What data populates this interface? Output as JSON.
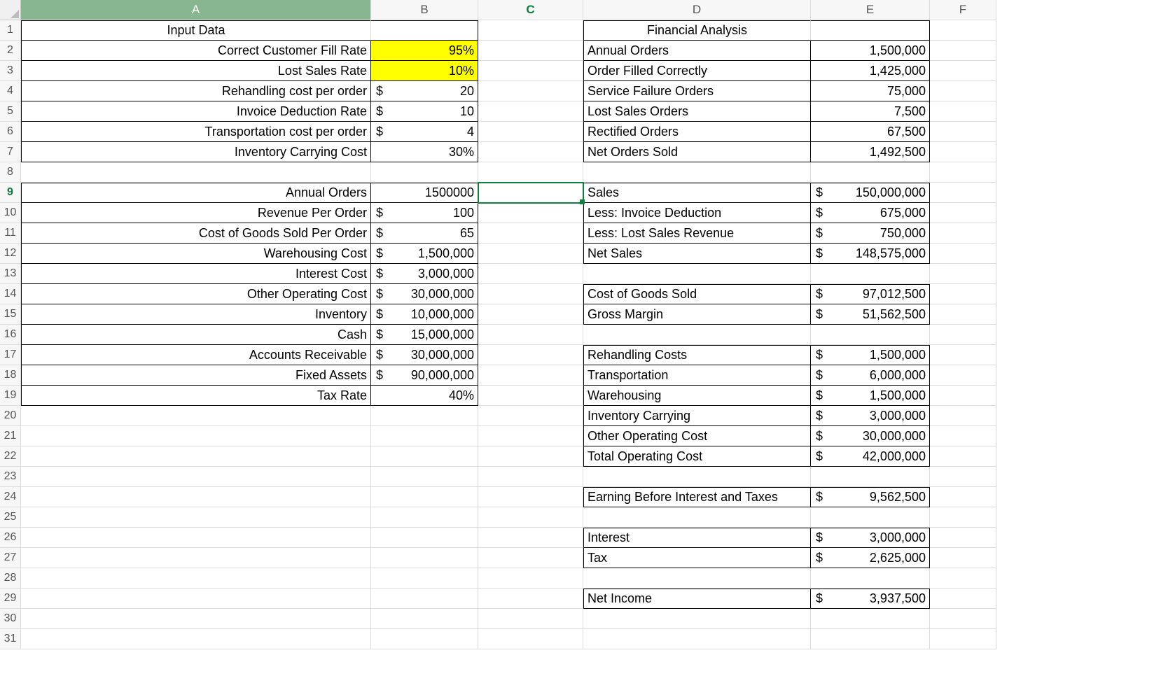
{
  "columns": [
    "A",
    "B",
    "C",
    "D",
    "E",
    "F"
  ],
  "rowCount": 31,
  "activeCell": {
    "row": 9,
    "col": "C"
  },
  "selectedColumn": "A",
  "cells": {
    "A1": {
      "v": "Input Data",
      "align": "center",
      "b": "bl bt bb"
    },
    "B1": {
      "v": "",
      "b": "bt br bb"
    },
    "A2": {
      "v": "Correct Customer Fill Rate",
      "align": "right",
      "b": "bl bb br"
    },
    "B2": {
      "v": "95%",
      "align": "right",
      "cls": "yellow",
      "b": "br bb"
    },
    "A3": {
      "v": "Lost Sales Rate",
      "align": "right",
      "b": "bl bb br"
    },
    "B3": {
      "v": "10%",
      "align": "right",
      "cls": "yellow",
      "b": "br bb"
    },
    "A4": {
      "v": "Rehandling cost per order",
      "align": "right",
      "b": "bl bb br"
    },
    "B4": {
      "v": "20",
      "acct": true,
      "b": "br bb"
    },
    "A5": {
      "v": "Invoice Deduction Rate",
      "align": "right",
      "b": "bl bb br"
    },
    "B5": {
      "v": "10",
      "acct": true,
      "b": "br bb"
    },
    "A6": {
      "v": "Transportation cost per order",
      "align": "right",
      "b": "bl bb br"
    },
    "B6": {
      "v": "4",
      "acct": true,
      "b": "br bb"
    },
    "A7": {
      "v": "Inventory Carrying Cost",
      "align": "right",
      "b": "bl bb br"
    },
    "B7": {
      "v": "30%",
      "align": "right",
      "b": "br bb"
    },
    "A9": {
      "v": "Annual Orders",
      "align": "right",
      "b": "bl bt bb br"
    },
    "B9": {
      "v": "1500000",
      "align": "right",
      "b": "bt br bb"
    },
    "A10": {
      "v": "Revenue Per Order",
      "align": "right",
      "b": "bl bb br"
    },
    "B10": {
      "v": "100",
      "acct": true,
      "b": "br bb"
    },
    "A11": {
      "v": "Cost of Goods Sold Per Order",
      "align": "right",
      "b": "bl bb br"
    },
    "B11": {
      "v": "65",
      "acct": true,
      "b": "br bb"
    },
    "A12": {
      "v": "Warehousing Cost",
      "align": "right",
      "b": "bl bb br"
    },
    "B12": {
      "v": "1,500,000",
      "acct": true,
      "b": "br bb"
    },
    "A13": {
      "v": "Interest Cost",
      "align": "right",
      "b": "bl bb br"
    },
    "B13": {
      "v": "3,000,000",
      "acct": true,
      "b": "br bb"
    },
    "A14": {
      "v": "Other Operating Cost",
      "align": "right",
      "b": "bl bb br"
    },
    "B14": {
      "v": "30,000,000",
      "acct": true,
      "b": "br bb"
    },
    "A15": {
      "v": "Inventory",
      "align": "right",
      "b": "bl bb br"
    },
    "B15": {
      "v": "10,000,000",
      "acct": true,
      "b": "br bb"
    },
    "A16": {
      "v": "Cash",
      "align": "right",
      "b": "bl bb br"
    },
    "B16": {
      "v": "15,000,000",
      "acct": true,
      "b": "br bb"
    },
    "A17": {
      "v": "Accounts Receivable",
      "align": "right",
      "b": "bl bb br"
    },
    "B17": {
      "v": "30,000,000",
      "acct": true,
      "b": "br bb"
    },
    "A18": {
      "v": "Fixed Assets",
      "align": "right",
      "b": "bl bb br"
    },
    "B18": {
      "v": "90,000,000",
      "acct": true,
      "b": "br bb"
    },
    "A19": {
      "v": "Tax Rate",
      "align": "right",
      "b": "bl bb br"
    },
    "B19": {
      "v": "40%",
      "align": "right",
      "b": "br bb"
    },
    "D1": {
      "v": "Financial Analysis",
      "align": "center",
      "b": "bl bt bb"
    },
    "E1": {
      "v": "",
      "b": "bt br bb"
    },
    "D2": {
      "v": "Annual Orders",
      "align": "left",
      "b": "bl bb br"
    },
    "E2": {
      "v": "1,500,000",
      "align": "right",
      "b": "br bb"
    },
    "D3": {
      "v": "Order Filled Correctly",
      "align": "left",
      "b": "bl bb br"
    },
    "E3": {
      "v": "1,425,000",
      "align": "right",
      "b": "br bb"
    },
    "D4": {
      "v": "Service Failure Orders",
      "align": "left",
      "b": "bl bb br"
    },
    "E4": {
      "v": "75,000",
      "align": "right",
      "b": "br bb"
    },
    "D5": {
      "v": "Lost Sales Orders",
      "align": "left",
      "b": "bl bb br"
    },
    "E5": {
      "v": "7,500",
      "align": "right",
      "b": "br bb"
    },
    "D6": {
      "v": "Rectified Orders",
      "align": "left",
      "b": "bl bb br"
    },
    "E6": {
      "v": "67,500",
      "align": "right",
      "b": "br bb"
    },
    "D7": {
      "v": "Net Orders Sold",
      "align": "left",
      "b": "bl bb br"
    },
    "E7": {
      "v": "1,492,500",
      "align": "right",
      "b": "br bb"
    },
    "D9": {
      "v": "Sales",
      "align": "left",
      "b": "bl bt bb br"
    },
    "E9": {
      "v": "150,000,000",
      "acct": true,
      "b": "bt br bb"
    },
    "D10": {
      "v": "Less: Invoice Deduction",
      "align": "left",
      "b": "bl bb br"
    },
    "E10": {
      "v": "675,000",
      "acct": true,
      "b": "br bb"
    },
    "D11": {
      "v": "Less: Lost Sales Revenue",
      "align": "left",
      "b": "bl bb br"
    },
    "E11": {
      "v": "750,000",
      "acct": true,
      "b": "br bb"
    },
    "D12": {
      "v": "Net Sales",
      "align": "left",
      "b": "bl bb br"
    },
    "E12": {
      "v": "148,575,000",
      "acct": true,
      "b": "br bb"
    },
    "D14": {
      "v": "Cost of Goods Sold",
      "align": "left",
      "b": "bl bt bb br"
    },
    "E14": {
      "v": "97,012,500",
      "acct": true,
      "b": "bt br bb"
    },
    "D15": {
      "v": "Gross Margin",
      "align": "left",
      "b": "bl bb br"
    },
    "E15": {
      "v": "51,562,500",
      "acct": true,
      "b": "br bb"
    },
    "D17": {
      "v": "Rehandling Costs",
      "align": "left",
      "b": "bl bt bb br"
    },
    "E17": {
      "v": "1,500,000",
      "acct": true,
      "b": "bt br bb"
    },
    "D18": {
      "v": "Transportation",
      "align": "left",
      "b": "bl bb br"
    },
    "E18": {
      "v": "6,000,000",
      "acct": true,
      "b": "br bb"
    },
    "D19": {
      "v": "Warehousing",
      "align": "left",
      "b": "bl bb br"
    },
    "E19": {
      "v": "1,500,000",
      "acct": true,
      "b": "br bb"
    },
    "D20": {
      "v": "Inventory Carrying",
      "align": "left",
      "b": "bl bb br"
    },
    "E20": {
      "v": "3,000,000",
      "acct": true,
      "b": "br bb"
    },
    "D21": {
      "v": "Other Operating Cost",
      "align": "left",
      "b": "bl bb br"
    },
    "E21": {
      "v": "30,000,000",
      "acct": true,
      "b": "br bb"
    },
    "D22": {
      "v": "Total Operating Cost",
      "align": "left",
      "b": "bl bb br"
    },
    "E22": {
      "v": "42,000,000",
      "acct": true,
      "b": "br bb"
    },
    "D24": {
      "v": "Earning Before Interest and Taxes",
      "align": "left",
      "b": "bl bt bb br"
    },
    "E24": {
      "v": "9,562,500",
      "acct": true,
      "b": "bt br bb"
    },
    "D26": {
      "v": "Interest",
      "align": "left",
      "b": "bl bt bb br"
    },
    "E26": {
      "v": "3,000,000",
      "acct": true,
      "b": "bt br bb"
    },
    "D27": {
      "v": "Tax",
      "align": "left",
      "b": "bl bb br"
    },
    "E27": {
      "v": "2,625,000",
      "acct": true,
      "b": "br bb"
    },
    "D29": {
      "v": "Net Income",
      "align": "left",
      "b": "bl bt bb br"
    },
    "E29": {
      "v": "3,937,500",
      "acct": true,
      "b": "bt br bb"
    }
  }
}
